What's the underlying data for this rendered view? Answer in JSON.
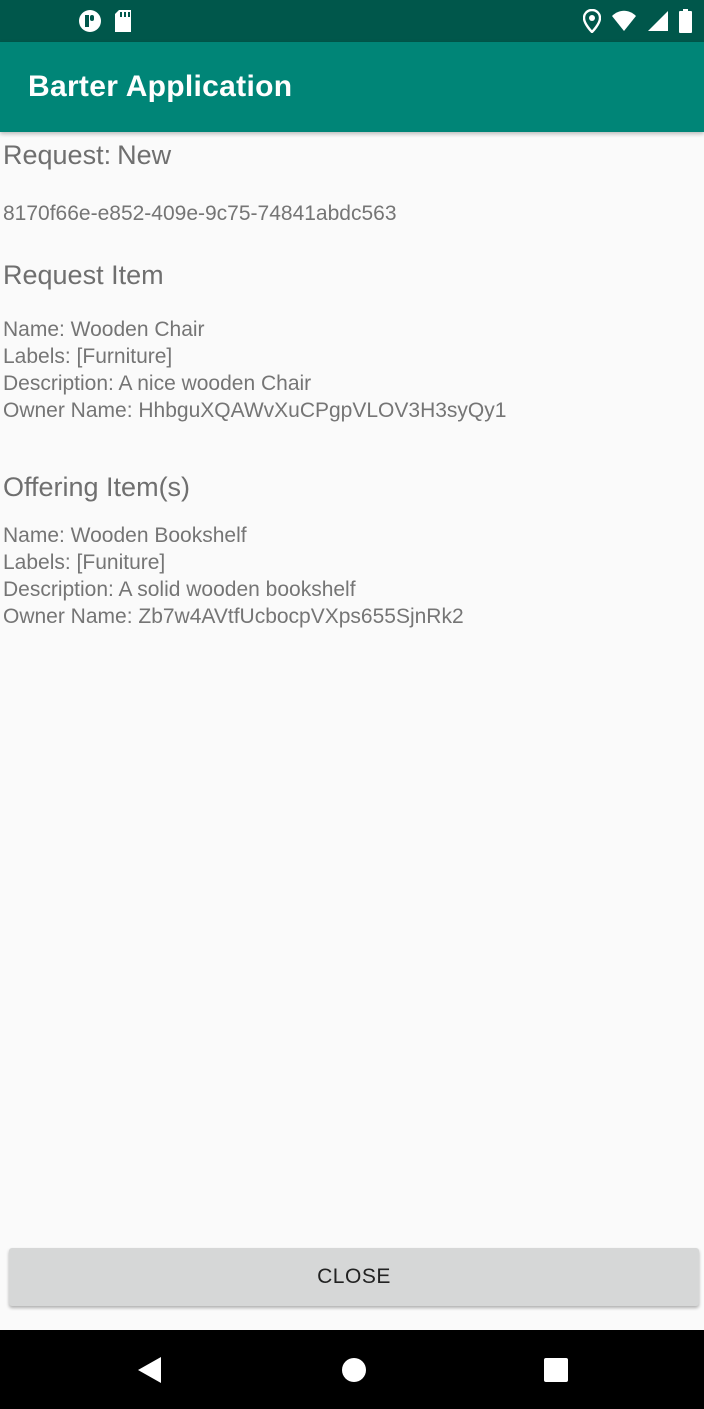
{
  "app": {
    "title": "Barter Application"
  },
  "request": {
    "label": "Request:",
    "status": "New",
    "id": "8170f66e-e852-409e-9c75-74841abdc563"
  },
  "request_item": {
    "heading": "Request Item",
    "name": "Name: Wooden Chair",
    "labels": "Labels: [Furniture]",
    "description": "Description: A nice wooden Chair",
    "owner": "Owner Name: HhbguXQAWvXuCPgpVLOV3H3syQy1"
  },
  "offering_item": {
    "heading": "Offering Item(s)",
    "name": "Name: Wooden Bookshelf",
    "labels": "Labels: [Funiture]",
    "description": "Description: A solid wooden bookshelf",
    "owner": "Owner Name: Zb7w4AVtfUcbocpVXps655SjnRk2"
  },
  "actions": {
    "close_label": "CLOSE"
  },
  "status_bar": {
    "left_icons": [
      "app-notification-icon",
      "sd-card-icon"
    ],
    "right_icons": [
      "location-icon",
      "wifi-icon",
      "cell-signal-icon",
      "battery-icon"
    ]
  },
  "nav_bar": {
    "icons": [
      "back-icon",
      "home-icon",
      "recents-icon"
    ]
  },
  "colors": {
    "primary": "#008577",
    "primary_dark": "#00574b",
    "button": "#d6d7d7"
  }
}
